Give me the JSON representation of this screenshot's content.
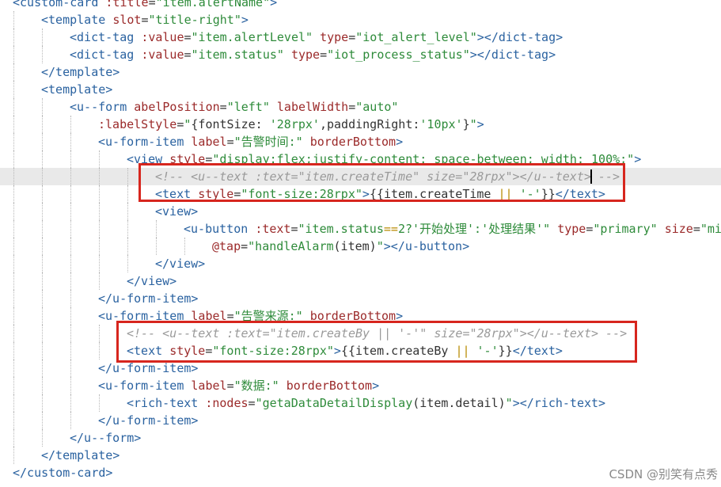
{
  "editor": {
    "lines": [
      {
        "indent": 0,
        "tokens": [
          [
            "tag",
            "<custom-card"
          ],
          [
            "txt",
            " "
          ],
          [
            "attr",
            ":title"
          ],
          [
            "txt",
            "="
          ],
          [
            "str",
            "\"item.alertName\""
          ],
          [
            "tag",
            ">"
          ]
        ]
      },
      {
        "indent": 1,
        "tokens": [
          [
            "tag",
            "<template"
          ],
          [
            "txt",
            " "
          ],
          [
            "attr",
            "slot"
          ],
          [
            "txt",
            "="
          ],
          [
            "str",
            "\"title-right\""
          ],
          [
            "tag",
            ">"
          ]
        ]
      },
      {
        "indent": 2,
        "tokens": [
          [
            "tag",
            "<dict-tag"
          ],
          [
            "txt",
            " "
          ],
          [
            "attr",
            ":value"
          ],
          [
            "txt",
            "="
          ],
          [
            "str",
            "\"item.alertLevel\""
          ],
          [
            "txt",
            " "
          ],
          [
            "attr",
            "type"
          ],
          [
            "txt",
            "="
          ],
          [
            "str",
            "\"iot_alert_level\""
          ],
          [
            "tag",
            "></dict-tag>"
          ]
        ]
      },
      {
        "indent": 2,
        "tokens": [
          [
            "tag",
            "<dict-tag"
          ],
          [
            "txt",
            " "
          ],
          [
            "attr",
            ":value"
          ],
          [
            "txt",
            "="
          ],
          [
            "str",
            "\"item.status\""
          ],
          [
            "txt",
            " "
          ],
          [
            "attr",
            "type"
          ],
          [
            "txt",
            "="
          ],
          [
            "str",
            "\"iot_process_status\""
          ],
          [
            "tag",
            "></dict-tag>"
          ]
        ]
      },
      {
        "indent": 1,
        "tokens": [
          [
            "tag",
            "</template>"
          ]
        ]
      },
      {
        "indent": 1,
        "tokens": [
          [
            "tag",
            "<template>"
          ]
        ]
      },
      {
        "indent": 2,
        "tokens": [
          [
            "tag",
            "<u--form"
          ],
          [
            "txt",
            " "
          ],
          [
            "attr",
            "abelPosition"
          ],
          [
            "txt",
            "="
          ],
          [
            "str",
            "\"left\""
          ],
          [
            "txt",
            " "
          ],
          [
            "attr",
            "labelWidth"
          ],
          [
            "txt",
            "="
          ],
          [
            "str",
            "\"auto\""
          ]
        ]
      },
      {
        "indent": 3,
        "tokens": [
          [
            "attr",
            ":labelStyle"
          ],
          [
            "txt",
            "="
          ],
          [
            "str",
            "\""
          ],
          [
            "txt",
            "{fontSize: "
          ],
          [
            "str",
            "'28rpx'"
          ],
          [
            "txt",
            ",paddingRight:"
          ],
          [
            "str",
            "'10px'"
          ],
          [
            "txt",
            "}"
          ],
          [
            "str",
            "\""
          ],
          [
            "tag",
            ">"
          ]
        ]
      },
      {
        "indent": 3,
        "tokens": [
          [
            "tag",
            "<u-form-item"
          ],
          [
            "txt",
            " "
          ],
          [
            "attr",
            "label"
          ],
          [
            "txt",
            "="
          ],
          [
            "str",
            "\"告警时间:\""
          ],
          [
            "txt",
            " "
          ],
          [
            "attr",
            "borderBottom"
          ],
          [
            "tag",
            ">"
          ]
        ]
      },
      {
        "indent": 4,
        "tokens": [
          [
            "tag",
            "<view"
          ],
          [
            "txt",
            " "
          ],
          [
            "attr",
            "style"
          ],
          [
            "txt",
            "="
          ],
          [
            "str",
            "\"display:flex;justify-content: space-between; width: 100%;\""
          ],
          [
            "tag",
            ">"
          ]
        ]
      },
      {
        "indent": 5,
        "highlight": true,
        "caret_after_token": 0,
        "tokens": [
          [
            "cmt",
            "<!-- <u--text :text=\"item.createTime\" size=\"28rpx\"></u--text>"
          ],
          [
            "cmt",
            " -->"
          ]
        ]
      },
      {
        "indent": 5,
        "tokens": [
          [
            "tag",
            "<text"
          ],
          [
            "txt",
            " "
          ],
          [
            "attr",
            "style"
          ],
          [
            "txt",
            "="
          ],
          [
            "str",
            "\"font-size:28rpx\""
          ],
          [
            "tag",
            ">"
          ],
          [
            "txt",
            "{{item.createTime "
          ],
          [
            "op",
            "||"
          ],
          [
            "txt",
            " "
          ],
          [
            "str",
            "'-'"
          ],
          [
            "txt",
            "}}"
          ],
          [
            "tag",
            "</text>"
          ]
        ]
      },
      {
        "indent": 5,
        "tokens": [
          [
            "tag",
            "<view>"
          ]
        ]
      },
      {
        "indent": 6,
        "tokens": [
          [
            "tag",
            "<u-button"
          ],
          [
            "txt",
            " "
          ],
          [
            "attr",
            ":text"
          ],
          [
            "txt",
            "="
          ],
          [
            "str",
            "\"item.status"
          ],
          [
            "op",
            "=="
          ],
          [
            "str",
            "2?'开始处理':'处理结果'\""
          ],
          [
            "txt",
            " "
          ],
          [
            "attr",
            "type"
          ],
          [
            "txt",
            "="
          ],
          [
            "str",
            "\"primary\""
          ],
          [
            "txt",
            " "
          ],
          [
            "attr",
            "size"
          ],
          [
            "txt",
            "="
          ],
          [
            "str",
            "\"mi"
          ]
        ]
      },
      {
        "indent": 7,
        "tokens": [
          [
            "attr",
            "@tap"
          ],
          [
            "txt",
            "="
          ],
          [
            "str",
            "\"handleAlarm"
          ],
          [
            "txt",
            "(item)"
          ],
          [
            "str",
            "\""
          ],
          [
            "tag",
            "></u-button>"
          ]
        ]
      },
      {
        "indent": 5,
        "tokens": [
          [
            "tag",
            "</view>"
          ]
        ]
      },
      {
        "indent": 4,
        "tokens": [
          [
            "tag",
            "</view>"
          ]
        ]
      },
      {
        "indent": 3,
        "tokens": [
          [
            "tag",
            "</u-form-item>"
          ]
        ]
      },
      {
        "indent": 3,
        "tokens": [
          [
            "tag",
            "<u-form-item"
          ],
          [
            "txt",
            " "
          ],
          [
            "attr",
            "label"
          ],
          [
            "txt",
            "="
          ],
          [
            "str",
            "\"告警来源:\""
          ],
          [
            "txt",
            " "
          ],
          [
            "attr",
            "borderBottom"
          ],
          [
            "tag",
            ">"
          ]
        ]
      },
      {
        "indent": 4,
        "tokens": [
          [
            "cmt",
            "<!-- <u--text :text=\"item.createBy || '-'\" size=\"28rpx\"></u--text> -->"
          ]
        ]
      },
      {
        "indent": 4,
        "tokens": [
          [
            "tag",
            "<text"
          ],
          [
            "txt",
            " "
          ],
          [
            "attr",
            "style"
          ],
          [
            "txt",
            "="
          ],
          [
            "str",
            "\"font-size:28rpx\""
          ],
          [
            "tag",
            ">"
          ],
          [
            "txt",
            "{{item.createBy "
          ],
          [
            "op",
            "||"
          ],
          [
            "txt",
            " "
          ],
          [
            "str",
            "'-'"
          ],
          [
            "txt",
            "}}"
          ],
          [
            "tag",
            "</text>"
          ]
        ]
      },
      {
        "indent": 3,
        "tokens": [
          [
            "tag",
            "</u-form-item>"
          ]
        ]
      },
      {
        "indent": 3,
        "tokens": [
          [
            "tag",
            "<u-form-item"
          ],
          [
            "txt",
            " "
          ],
          [
            "attr",
            "label"
          ],
          [
            "txt",
            "="
          ],
          [
            "str",
            "\"数据:\""
          ],
          [
            "txt",
            " "
          ],
          [
            "attr",
            "borderBottom"
          ],
          [
            "tag",
            ">"
          ]
        ]
      },
      {
        "indent": 4,
        "tokens": [
          [
            "tag",
            "<rich-text"
          ],
          [
            "txt",
            " "
          ],
          [
            "attr",
            ":nodes"
          ],
          [
            "txt",
            "="
          ],
          [
            "str",
            "\"getaDataDetailDisplay"
          ],
          [
            "txt",
            "(item.detail)"
          ],
          [
            "str",
            "\""
          ],
          [
            "tag",
            "></rich-text>"
          ]
        ]
      },
      {
        "indent": 3,
        "tokens": [
          [
            "tag",
            "</u-form-item>"
          ]
        ]
      },
      {
        "indent": 2,
        "tokens": [
          [
            "tag",
            "</u--form>"
          ]
        ]
      },
      {
        "indent": 1,
        "tokens": [
          [
            "tag",
            "</template>"
          ]
        ]
      },
      {
        "indent": 0,
        "tokens": [
          [
            "tag",
            "</custom-card>"
          ]
        ]
      }
    ]
  },
  "colors": {
    "tag": "#2a62a0",
    "attribute": "#9b2a2a",
    "string": "#2e8b3a",
    "comment": "#9a9a9a",
    "operator": "#b88a00",
    "highlight_box": "#d7261e"
  },
  "watermark": "CSDN @别笑有点秀"
}
